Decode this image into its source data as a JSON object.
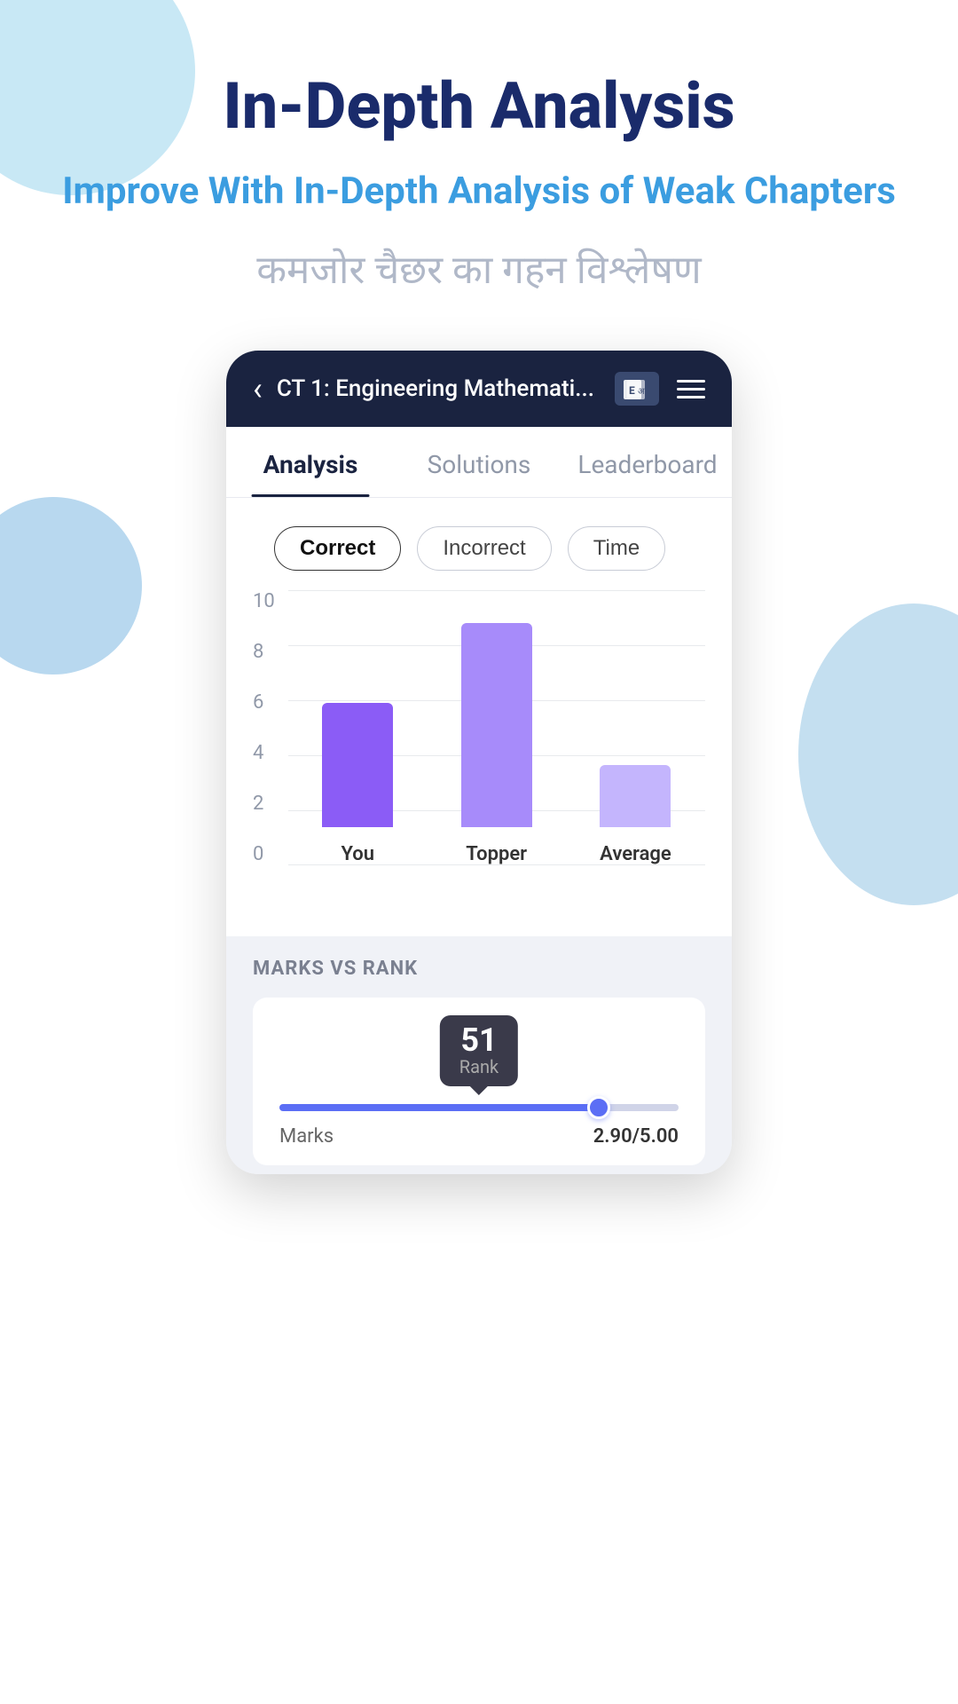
{
  "page": {
    "main_title": "In-Depth Analysis",
    "subtitle_en": "Improve With In-Depth Analysis of Weak Chapters",
    "subtitle_hi": "कमजोर चैछर का गहन विश्लेषण"
  },
  "phone": {
    "header": {
      "title": "CT 1: Engineering Mathemati...",
      "back_label": "‹"
    },
    "tabs": [
      {
        "id": "analysis",
        "label": "Analysis",
        "active": true
      },
      {
        "id": "solutions",
        "label": "Solutions",
        "active": false
      },
      {
        "id": "leaderboard",
        "label": "Leaderboard",
        "active": false
      }
    ],
    "filter_buttons": [
      {
        "id": "correct",
        "label": "Correct",
        "active": true
      },
      {
        "id": "incorrect",
        "label": "Incorrect",
        "active": false
      },
      {
        "id": "time",
        "label": "Time",
        "active": false
      }
    ],
    "chart": {
      "y_labels": [
        "10",
        "8",
        "6",
        "4",
        "2",
        "0"
      ],
      "bars": [
        {
          "id": "you",
          "label": "You",
          "height_pct": 40
        },
        {
          "id": "topper",
          "label": "Topper",
          "height_pct": 66
        },
        {
          "id": "average",
          "label": "Average",
          "height_pct": 20
        }
      ]
    },
    "marks_vs_rank": {
      "section_label": "MARKS VS RANK",
      "rank_number": "51",
      "rank_label": "Rank",
      "slider_position_pct": 80,
      "marks_key": "Marks",
      "marks_value": "2.90/5.00"
    }
  }
}
